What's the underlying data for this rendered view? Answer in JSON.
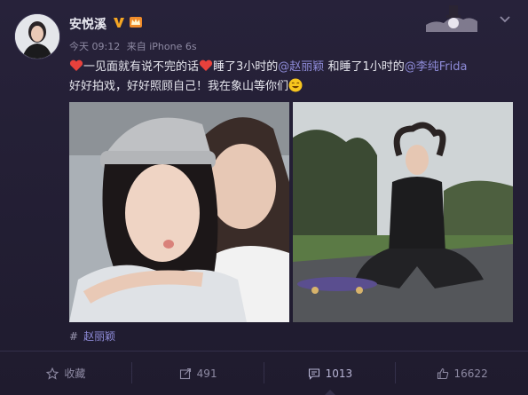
{
  "post": {
    "author": "安悦溪",
    "time": "今天 09:12",
    "source_prefix": "来自",
    "source": "iPhone 6s",
    "text": {
      "part1": "一见面就有说不完的话",
      "part2": "睡了3小时的",
      "mention1": "@赵丽颖",
      "part3": " 和睡了1小时的",
      "mention2": "@李纯Frida",
      "line2": "好好拍戏，好好照顾自己！我在象山等你们"
    },
    "topic": "赵丽颖",
    "topic_hash": "#"
  },
  "actions": {
    "favorite": "收藏",
    "repost": "491",
    "comment": "1013",
    "like": "16622"
  },
  "colors": {
    "background": "#1f1b2e",
    "mention": "#8e8bd8",
    "muted": "#8e8aa3",
    "heart": "#e8413c",
    "verified": "#f5a623"
  },
  "icons": [
    "verified-icon",
    "crown-badge-icon",
    "chevron-down-icon",
    "heart-emoji-icon",
    "smile-emoji-icon",
    "hash-icon",
    "star-icon",
    "repost-icon",
    "comment-icon",
    "like-icon"
  ]
}
